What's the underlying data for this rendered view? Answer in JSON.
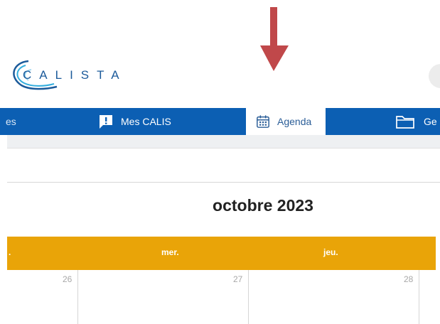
{
  "logo": {
    "text": "CALISTA"
  },
  "nav": {
    "items": [
      {
        "label": "es",
        "icon": "partial-tab"
      },
      {
        "label": "Mes CALIS",
        "icon": "exclamation-message-icon"
      },
      {
        "label": "Agenda",
        "icon": "calendar-icon",
        "active": true
      },
      {
        "label": "Ge",
        "icon": "folder-icon"
      }
    ]
  },
  "calendar": {
    "title": "octobre 2023",
    "days": [
      {
        "name": ""
      },
      {
        "name": "mer."
      },
      {
        "name": "jeu."
      }
    ],
    "dates": [
      "26",
      "27",
      "28"
    ]
  },
  "colors": {
    "nav_blue": "#0c5fb3",
    "header_orange": "#e9a408",
    "arrow_red": "#c0484a",
    "logo_blue": "#1b5a9a"
  }
}
